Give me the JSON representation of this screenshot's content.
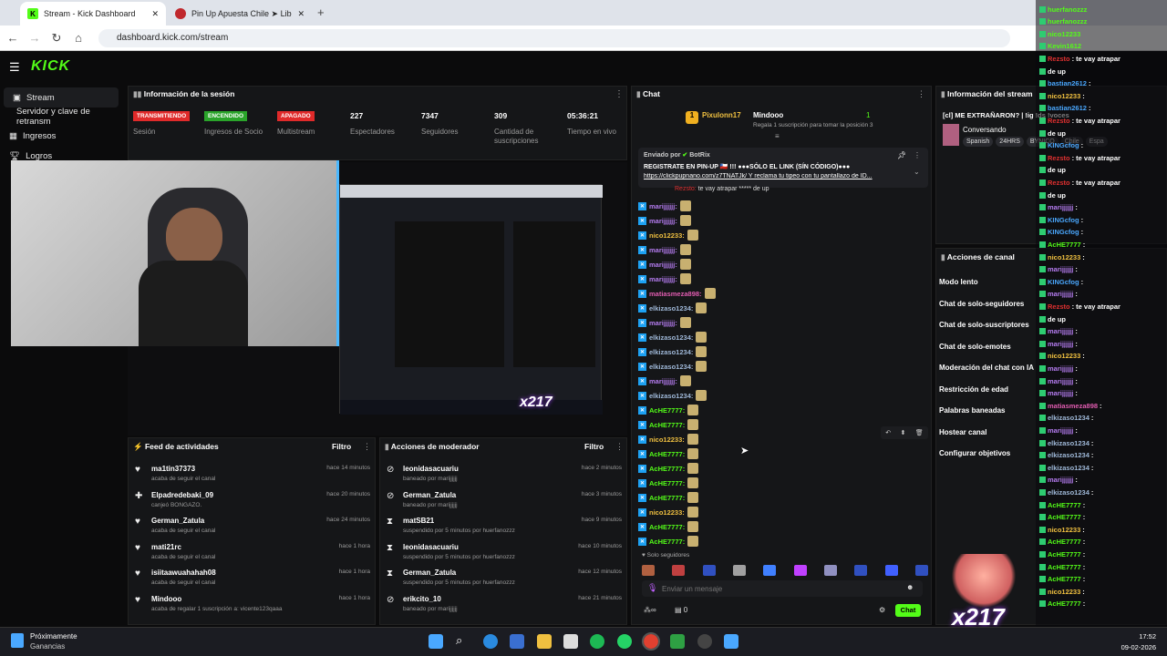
{
  "browser": {
    "tabs": [
      {
        "label": "Stream - Kick Dashboard",
        "active": true
      },
      {
        "label": "Pin Up Apuesta Chile ➤ Libro d",
        "active": false
      }
    ],
    "url": "dashboard.kick.com/stream"
  },
  "logo": "KICK",
  "sidebar": {
    "items": [
      {
        "label": "Stream",
        "selected": true
      },
      {
        "label": "Servidor y clave de retransm"
      },
      {
        "label": "Ingresos"
      },
      {
        "label": "Logros"
      }
    ]
  },
  "session": {
    "title": "Información de la sesión",
    "cols": [
      {
        "badge": "TRANSMITIENDO",
        "badge_color": "#e02a2a",
        "label": "Sesión"
      },
      {
        "badge": "ENCENDIDO",
        "badge_color": "#2aa42a",
        "label": "Ingresos de Socio"
      },
      {
        "badge": "APAGADO",
        "badge_color": "#e02a2a",
        "label": "Multistream"
      },
      {
        "value": "227",
        "label": "Espectadores"
      },
      {
        "value": "7347",
        "label": "Seguidores"
      },
      {
        "value": "309",
        "label": "Cantidad de suscripciones"
      },
      {
        "value": "05:36:21",
        "label": "Tiempo en vivo"
      }
    ]
  },
  "feed": {
    "title": "Feed de actividades",
    "filter": "Filtro",
    "items": [
      {
        "name": "ma1tin37373",
        "sub": "acaba de seguir el canal",
        "time": "hace 14 minutos",
        "icon": "♥"
      },
      {
        "name": "Elpadredebaki_09",
        "sub": "canjeó BONGAZO.",
        "time": "hace 20 minutos",
        "icon": "✚"
      },
      {
        "name": "German_Zatula",
        "sub": "acaba de seguir el canal",
        "time": "hace 24 minutos",
        "icon": "♥"
      },
      {
        "name": "mati21rc",
        "sub": "acaba de seguir el canal",
        "time": "hace 1 hora",
        "icon": "♥"
      },
      {
        "name": "isiitaawuahahah08",
        "sub": "acaba de seguir el canal",
        "time": "hace 1 hora",
        "icon": "♥"
      },
      {
        "name": "Mindooo",
        "sub": "acaba de regalar 1 suscripción a: vicente123qaaa",
        "time": "hace 1 hora",
        "icon": "♥",
        "green": true
      }
    ]
  },
  "mod": {
    "title": "Acciones de moderador",
    "filter": "Filtro",
    "items": [
      {
        "name": "leonidasacuariu",
        "sub": "baneado por marijjjjjj",
        "time": "hace 2 minutos",
        "icon": "⊘"
      },
      {
        "name": "German_Zatula",
        "sub": "baneado por marijjjjjj",
        "time": "hace 3 minutos",
        "icon": "⊘"
      },
      {
        "name": "matSB21",
        "sub": "suspendido por 5 minutos por huerfanozzz",
        "time": "hace 9 minutos",
        "icon": "⧗"
      },
      {
        "name": "leonidasacuariu",
        "sub": "suspendido por 5 minutos por huerfanozzz",
        "time": "hace 10 minutos",
        "icon": "⧗"
      },
      {
        "name": "German_Zatula",
        "sub": "suspendido por 5 minutos por huerfanozzz",
        "time": "hace 12 minutos",
        "icon": "⧗"
      },
      {
        "name": "erikcito_10",
        "sub": "baneado por marijjjjjj",
        "time": "hace 21 minutos",
        "icon": "⊘"
      }
    ]
  },
  "chat": {
    "title": "Chat",
    "gift_top": "Pixulonn17",
    "gift_top2": "Mindooo",
    "gift_count": "1",
    "gift_text": "Regala 1 suscripción para tomar la posición 3",
    "pinned_by": "Enviado por",
    "pinned_user": "BotRix",
    "pinned_line1": "REGISTRATE EN PIN-UP 🇨🇱 !!! ●●●SÓLO EL LINK (SÍN CÓDIGO)●●●",
    "pinned_line2": "https://clickpupnano.com/z7TNATJk/ Y reclama tu tipeo con tu pantallazo de ID...",
    "reply_line": "te vay atrapar ***** de up",
    "lines": [
      {
        "u": "marijjjjjj:",
        "c": "#b57cf0"
      },
      {
        "u": "marijjjjjj:",
        "c": "#b57cf0"
      },
      {
        "u": "nico12233:",
        "c": "#f0c040"
      },
      {
        "u": "marijjjjjj:",
        "c": "#b57cf0"
      },
      {
        "u": "marijjjjjj:",
        "c": "#b57cf0"
      },
      {
        "u": "marijjjjjj:",
        "c": "#b57cf0"
      },
      {
        "u": "matiasmeza898:",
        "c": "#e05cb0"
      },
      {
        "u": "elkizaso1234:",
        "c": "#9fb8d8"
      },
      {
        "u": "marijjjjjj:",
        "c": "#b57cf0"
      },
      {
        "u": "elkizaso1234:",
        "c": "#9fb8d8"
      },
      {
        "u": "elkizaso1234:",
        "c": "#9fb8d8"
      },
      {
        "u": "elkizaso1234:",
        "c": "#9fb8d8"
      },
      {
        "u": "marijjjjjj:",
        "c": "#b57cf0"
      },
      {
        "u": "elkizaso1234:",
        "c": "#9fb8d8"
      },
      {
        "u": "AcHE7777:",
        "c": "#53fc18"
      },
      {
        "u": "AcHE7777:",
        "c": "#53fc18"
      },
      {
        "u": "nico12233:",
        "c": "#f0c040"
      },
      {
        "u": "AcHE7777:",
        "c": "#53fc18"
      },
      {
        "u": "AcHE7777:",
        "c": "#53fc18"
      },
      {
        "u": "AcHE7777:",
        "c": "#53fc18"
      },
      {
        "u": "AcHE7777:",
        "c": "#53fc18"
      },
      {
        "u": "nico12233:",
        "c": "#f0c040"
      },
      {
        "u": "AcHE7777:",
        "c": "#53fc18"
      },
      {
        "u": "AcHE7777:",
        "c": "#53fc18"
      }
    ],
    "followers_only": "Solo seguidores",
    "placeholder": "Enviar un mensaje",
    "send": "Chat",
    "count": "0"
  },
  "streaminfo": {
    "title": "Información del stream",
    "stream_title": "[cl] ME EXTRAÑARON? | !ig !ds !voces",
    "category": "Conversando",
    "tags": [
      "Spanish",
      "24HRS",
      "BYNICO",
      "Chile",
      "Espa"
    ]
  },
  "actions": {
    "title": "Acciones de canal",
    "items": [
      "Modo lento",
      "Chat de solo-seguidores",
      "Chat de solo-suscriptores",
      "Chat de solo-emotes",
      "Moderación del chat con IA",
      "Restricción de edad",
      "Palabras baneadas",
      "Hostear canal",
      "Configurar objetivos"
    ]
  },
  "overlay": {
    "lines": [
      {
        "u": "huerfanozzz",
        "c": "#53fc18"
      },
      {
        "u": "huerfanozzz",
        "c": "#53fc18"
      },
      {
        "u": "nico12233",
        "c": "#53fc18"
      },
      {
        "u": "Kevin1612",
        "c": "#53fc18"
      },
      {
        "u": "Rezsto",
        "c": "#e03030",
        "t": ": te vay atrapar"
      },
      {
        "u": "de up",
        "c": "#fff"
      },
      {
        "u": "bastian2612",
        "c": "#4aa8ff",
        "t": ":"
      },
      {
        "u": "nico12233",
        "c": "#f0c040",
        "t": ":"
      },
      {
        "u": "bastian2612",
        "c": "#4aa8ff",
        "t": ":"
      },
      {
        "u": "Rezsto",
        "c": "#e03030",
        "t": ": te vay atrapar"
      },
      {
        "u": "de up",
        "c": "#fff"
      },
      {
        "u": "KINGcfog",
        "c": "#4aa8ff",
        "t": ":"
      },
      {
        "u": "Rezsto",
        "c": "#e03030",
        "t": ": te vay atrapar"
      },
      {
        "u": "de up",
        "c": "#fff"
      },
      {
        "u": "Rezsto",
        "c": "#e03030",
        "t": ": te vay atrapar"
      },
      {
        "u": "de up",
        "c": "#fff"
      },
      {
        "u": "marijjjjjj",
        "c": "#b57cf0",
        "t": ":"
      },
      {
        "u": "KINGcfog",
        "c": "#4aa8ff",
        "t": ":"
      },
      {
        "u": "KINGcfog",
        "c": "#4aa8ff",
        "t": ":"
      },
      {
        "u": "AcHE7777",
        "c": "#53fc18",
        "t": ":"
      },
      {
        "u": "nico12233",
        "c": "#f0c040",
        "t": ":"
      },
      {
        "u": "marijjjjjj",
        "c": "#b57cf0",
        "t": ":"
      },
      {
        "u": "KINGcfog",
        "c": "#4aa8ff",
        "t": ":"
      },
      {
        "u": "marijjjjjj",
        "c": "#b57cf0",
        "t": ":"
      },
      {
        "u": "Rezsto",
        "c": "#e03030",
        "t": ": te vay atrapar"
      },
      {
        "u": "de up",
        "c": "#fff"
      },
      {
        "u": "marijjjjjj",
        "c": "#b57cf0",
        "t": ":"
      },
      {
        "u": "marijjjjjj",
        "c": "#b57cf0",
        "t": ":"
      },
      {
        "u": "nico12233",
        "c": "#f0c040",
        "t": ":"
      },
      {
        "u": "marijjjjjj",
        "c": "#b57cf0",
        "t": ":"
      },
      {
        "u": "marijjjjjj",
        "c": "#b57cf0",
        "t": ":"
      },
      {
        "u": "marijjjjjj",
        "c": "#b57cf0",
        "t": ":"
      },
      {
        "u": "matiasmeza898",
        "c": "#e05cb0",
        "t": ":"
      },
      {
        "u": "elkizaso1234",
        "c": "#9fb8d8",
        "t": ":"
      },
      {
        "u": "marijjjjjj",
        "c": "#b57cf0",
        "t": ":"
      },
      {
        "u": "elkizaso1234",
        "c": "#9fb8d8",
        "t": ":"
      },
      {
        "u": "elkizaso1234",
        "c": "#9fb8d8",
        "t": ":"
      },
      {
        "u": "elkizaso1234",
        "c": "#9fb8d8",
        "t": ":"
      },
      {
        "u": "marijjjjjj",
        "c": "#b57cf0",
        "t": ":"
      },
      {
        "u": "elkizaso1234",
        "c": "#9fb8d8",
        "t": ":"
      },
      {
        "u": "AcHE7777",
        "c": "#53fc18",
        "t": ":"
      },
      {
        "u": "AcHE7777",
        "c": "#53fc18",
        "t": ":"
      },
      {
        "u": "nico12233",
        "c": "#f0c040",
        "t": ":"
      },
      {
        "u": "AcHE7777",
        "c": "#53fc18",
        "t": ":"
      },
      {
        "u": "AcHE7777",
        "c": "#53fc18",
        "t": ":"
      },
      {
        "u": "AcHE7777",
        "c": "#53fc18",
        "t": ":"
      },
      {
        "u": "AcHE7777",
        "c": "#53fc18",
        "t": ":"
      },
      {
        "u": "nico12233",
        "c": "#f0c040",
        "t": ":"
      },
      {
        "u": "AcHE7777",
        "c": "#53fc18",
        "t": ":"
      }
    ],
    "x217": "x217"
  },
  "taskbar": {
    "weather_title": "Próximamente",
    "weather_sub": "Ganancias",
    "time": "17:52",
    "date": "09-02-2026"
  }
}
